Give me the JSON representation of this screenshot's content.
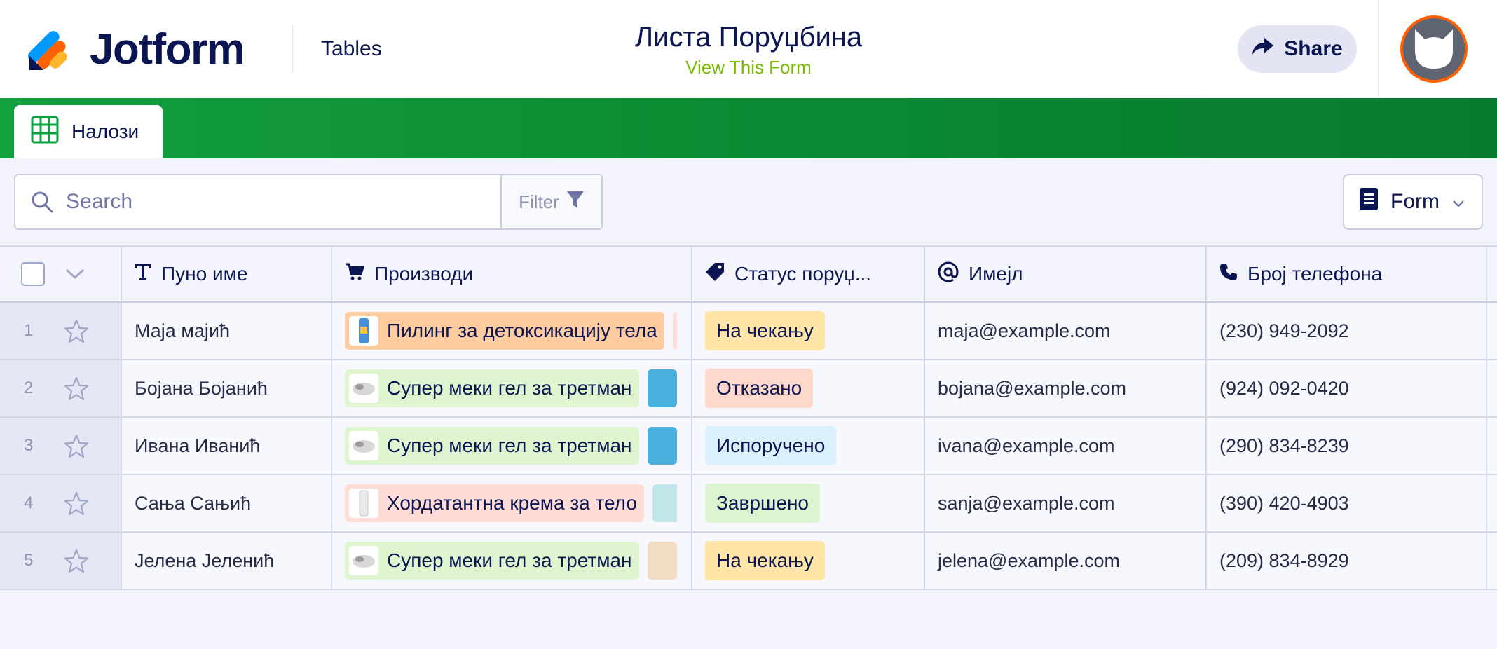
{
  "header": {
    "brand": "Jotform",
    "tables_link": "Tables",
    "form_title": "Листа Поруџбина",
    "view_form": "View This Form",
    "share_label": "Share"
  },
  "tab": {
    "label": "Налози"
  },
  "toolbar": {
    "search_placeholder": "Search",
    "filter_label": "Filter",
    "form_label": "Form"
  },
  "columns": [
    {
      "label": "Пуно име",
      "icon": "text-type-icon"
    },
    {
      "label": "Производи",
      "icon": "cart-icon"
    },
    {
      "label": "Статус поруџ...",
      "icon": "tag-icon"
    },
    {
      "label": "Имејл",
      "icon": "at-sign-icon"
    },
    {
      "label": "Број телефона",
      "icon": "phone-icon"
    }
  ],
  "rows": [
    {
      "num": "1",
      "name": "Маја мајић",
      "product": "Пилинг за детоксикацију тела",
      "status": "На чекању",
      "email": "maja@example.com",
      "phone": "(230) 949-2092"
    },
    {
      "num": "2",
      "name": "Бојана Бојанић",
      "product": "Супер меки гел за третман",
      "status": "Отказано",
      "email": "bojana@example.com",
      "phone": "(924) 092-0420"
    },
    {
      "num": "3",
      "name": "Ивана Иванић",
      "product": "Супер меки гел за третман",
      "status": "Испоручено",
      "email": "ivana@example.com",
      "phone": "(290) 834-8239"
    },
    {
      "num": "4",
      "name": "Сања Сањић",
      "product": "Хордатантна крема за тело",
      "status": "Завршено",
      "email": "sanja@example.com",
      "phone": "(390) 420-4903"
    },
    {
      "num": "5",
      "name": "Јелена Јеленић",
      "product": "Супер меки гел за третман",
      "status": "На чекању",
      "email": "jelena@example.com",
      "phone": "(209) 834-8929"
    }
  ],
  "colors": {
    "band_green": "#0a8b33",
    "accent_green_text": "#78bb07",
    "avatar_ring": "#ff6100",
    "status_pending": "#ffe5a8",
    "status_cancelled": "#ffd8cc",
    "status_delivered": "#dcf0fc",
    "status_completed": "#dbf5d0",
    "chip_orange": "#ffcc9f",
    "chip_green": "#def5d0",
    "chip_pink": "#ffdcd5"
  }
}
